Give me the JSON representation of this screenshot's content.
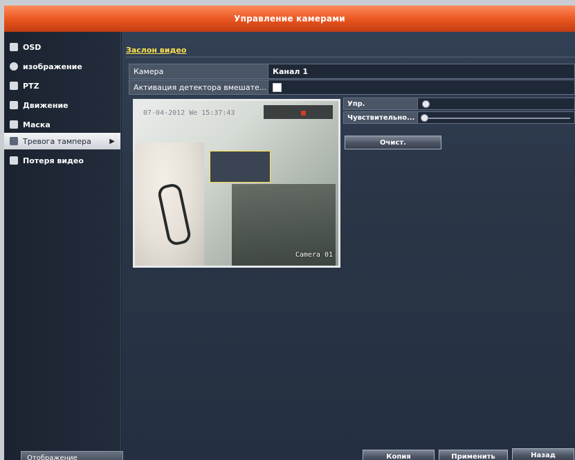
{
  "window": {
    "title": "Управление камерами"
  },
  "sidebar": {
    "items": [
      {
        "label": "OSD",
        "icon": "osd-icon"
      },
      {
        "label": "изображение",
        "icon": "image-icon"
      },
      {
        "label": "PTZ",
        "icon": "ptz-icon"
      },
      {
        "label": "Движение",
        "icon": "motion-icon"
      },
      {
        "label": "Маска",
        "icon": "mask-icon"
      },
      {
        "label": "Тревога тампера",
        "icon": "tamper-icon",
        "active": true
      },
      {
        "label": "Потеря видео",
        "icon": "video-loss-icon"
      }
    ],
    "bottom_button": "Отображение"
  },
  "main": {
    "tab": "Заслон видео",
    "camera_label": "Камера",
    "camera_value": "Канал 1",
    "detector_label": "Активация детектора вмешате...",
    "detector_checked": false,
    "preview": {
      "timestamp": "07-04-2012 We 15:37:43",
      "camera_name": "Camera 01"
    },
    "controls": {
      "control_label": "Упр.",
      "sensitivity_label": "Чувствительно...",
      "clear_button": "Очист."
    }
  },
  "footer": {
    "copy_button": "Копия",
    "apply_button": "Применить",
    "back_button": "Назад"
  },
  "colors": {
    "title_bar": "#e8541f",
    "tab_text": "#ffe14d",
    "panel_bg": "#2a3546"
  }
}
